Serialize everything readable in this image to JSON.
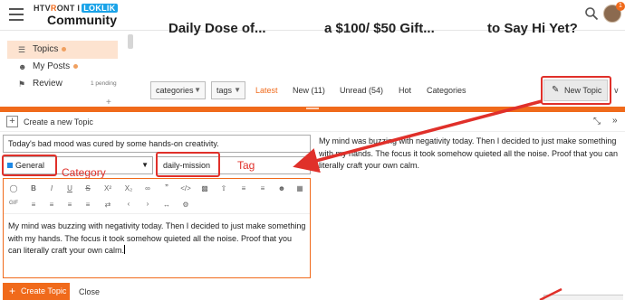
{
  "header": {
    "logo_top_a": "HTV",
    "logo_top_b": "R",
    "logo_top_c": "ONT I",
    "logo_top_lok": "LOKLIK",
    "logo_bottom": "Community",
    "notif_count": "1"
  },
  "sidebar": {
    "items": [
      {
        "label": "Topics",
        "icon": "list-icon"
      },
      {
        "label": "My Posts",
        "icon": "user-icon"
      },
      {
        "label": "Review",
        "icon": "flag-icon",
        "badge": "1 pending"
      }
    ]
  },
  "cards": [
    "Daily Dose of...",
    "a $100/ $50 Gift...",
    "to Say Hi Yet?"
  ],
  "nav": {
    "categories_chip": "categories",
    "tags_chip": "tags",
    "links": [
      "Latest",
      "New (11)",
      "Unread (54)",
      "Hot",
      "Categories"
    ],
    "new_topic": "New Topic"
  },
  "composer": {
    "header_label": "Create a new Topic",
    "title_value": "Today's bad mood was cured by some hands-on creativity.",
    "category_value": "General",
    "tag_value": "daily-mission",
    "annotation_category": "Category",
    "annotation_tag": "Tag",
    "body_text": "My mind was buzzing with negativity today. Then I decided to just make something with my hands. The focus it took somehow quieted all the noise. Proof that you can literally craft your own calm.",
    "preview_text": "My mind was buzzing with negativity today. Then I decided to just make something with my hands. The focus it took somehow quieted all the noise. Proof that you can literally craft your own calm.",
    "create_button": "Create Topic",
    "close_button": "Close"
  },
  "colors": {
    "accent": "#f06a1b",
    "annotation": "#e0302a",
    "category_square": "#1e88e5"
  }
}
